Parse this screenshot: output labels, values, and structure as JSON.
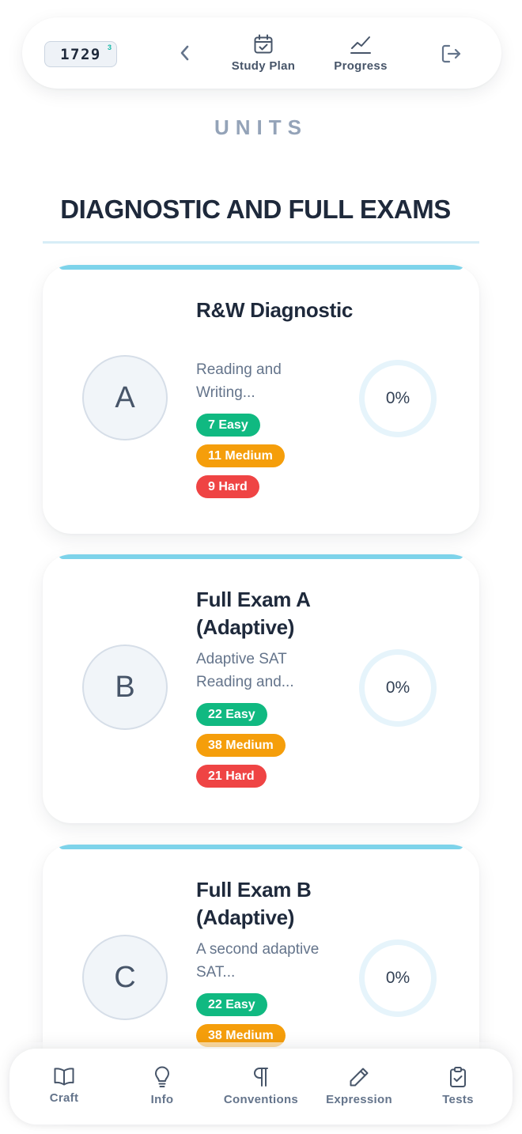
{
  "topbar": {
    "score": "1729",
    "score_sup": "3",
    "study_plan_label": "Study Plan",
    "progress_label": "Progress"
  },
  "units_label": "UNITS",
  "section_title": "DIAGNOSTIC AND FULL EXAMS",
  "cards": [
    {
      "letter": "A",
      "title": "R&W Diagnostic",
      "description": "Reading and Writing...",
      "easy": "7 Easy",
      "medium": "11 Medium",
      "hard": "9 Hard",
      "progress": "0%"
    },
    {
      "letter": "B",
      "title": "Full Exam A (Adaptive)",
      "description": "Adaptive SAT Reading and...",
      "easy": "22 Easy",
      "medium": "38 Medium",
      "hard": "21 Hard",
      "progress": "0%"
    },
    {
      "letter": "C",
      "title": "Full Exam B (Adaptive)",
      "description": "A second adaptive SAT...",
      "easy": "22 Easy",
      "medium": "38 Medium",
      "hard": "",
      "progress": "0%"
    }
  ],
  "bottom_nav": {
    "craft": "Craft",
    "info": "Info",
    "conventions": "Conventions",
    "expression": "Expression",
    "tests": "Tests"
  },
  "colors": {
    "easy": "#10b981",
    "medium": "#f59e0b",
    "hard": "#ef4444",
    "accent": "#7dd3ea"
  },
  "icons": {
    "study_plan": "calendar-check-icon",
    "progress": "chart-line-icon",
    "back": "chevron-left-icon",
    "logout": "logout-icon",
    "craft": "book-open-icon",
    "info": "lightbulb-icon",
    "conventions": "pilcrow-icon",
    "expression": "pencil-icon",
    "tests": "clipboard-check-icon"
  }
}
